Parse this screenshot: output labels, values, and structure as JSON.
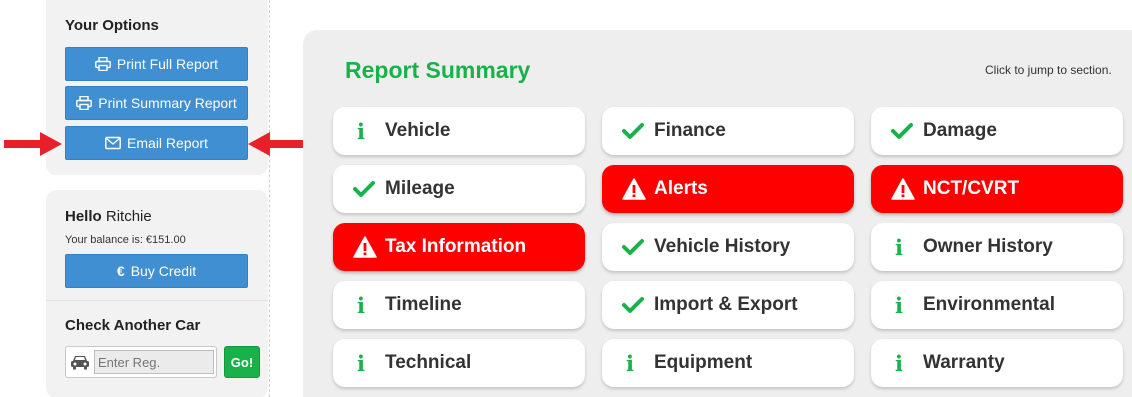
{
  "sidebar": {
    "options_title": "Your Options",
    "print_full": "Print Full Report",
    "print_summary": "Print Summary Report",
    "email_report": "Email Report",
    "hello_prefix": "Hello",
    "user_name": "Ritchie",
    "balance": "Your balance is: €151.00",
    "buy_credit": "Buy Credit",
    "buy_credit_symbol": "€",
    "check_title": "Check Another Car",
    "reg_placeholder": "Enter Reg.",
    "go": "Go!"
  },
  "summary": {
    "title": "Report Summary",
    "hint": "Click to jump to section.",
    "tiles": [
      {
        "label": "Vehicle",
        "icon": "info-icon",
        "status": "info"
      },
      {
        "label": "Finance",
        "icon": "check-icon",
        "status": "ok"
      },
      {
        "label": "Damage",
        "icon": "check-icon",
        "status": "ok"
      },
      {
        "label": "Mileage",
        "icon": "check-icon",
        "status": "ok"
      },
      {
        "label": "Alerts",
        "icon": "warning-icon",
        "status": "alert"
      },
      {
        "label": "NCT/CVRT",
        "icon": "warning-icon",
        "status": "alert"
      },
      {
        "label": "Tax Information",
        "icon": "warning-icon",
        "status": "alert"
      },
      {
        "label": "Vehicle History",
        "icon": "check-icon",
        "status": "ok"
      },
      {
        "label": "Owner History",
        "icon": "info-icon",
        "status": "info"
      },
      {
        "label": "Timeline",
        "icon": "info-icon",
        "status": "info"
      },
      {
        "label": "Import & Export",
        "icon": "check-icon",
        "status": "ok"
      },
      {
        "label": "Environmental",
        "icon": "info-icon",
        "status": "info"
      },
      {
        "label": "Technical",
        "icon": "info-icon",
        "status": "info"
      },
      {
        "label": "Equipment",
        "icon": "info-icon",
        "status": "info"
      },
      {
        "label": "Warranty",
        "icon": "info-icon",
        "status": "info"
      }
    ]
  },
  "colors": {
    "accent_green": "#19b24a",
    "button_blue": "#3f8fd2",
    "alert_red": "#ff0000",
    "arrow_red": "#e8202a"
  }
}
